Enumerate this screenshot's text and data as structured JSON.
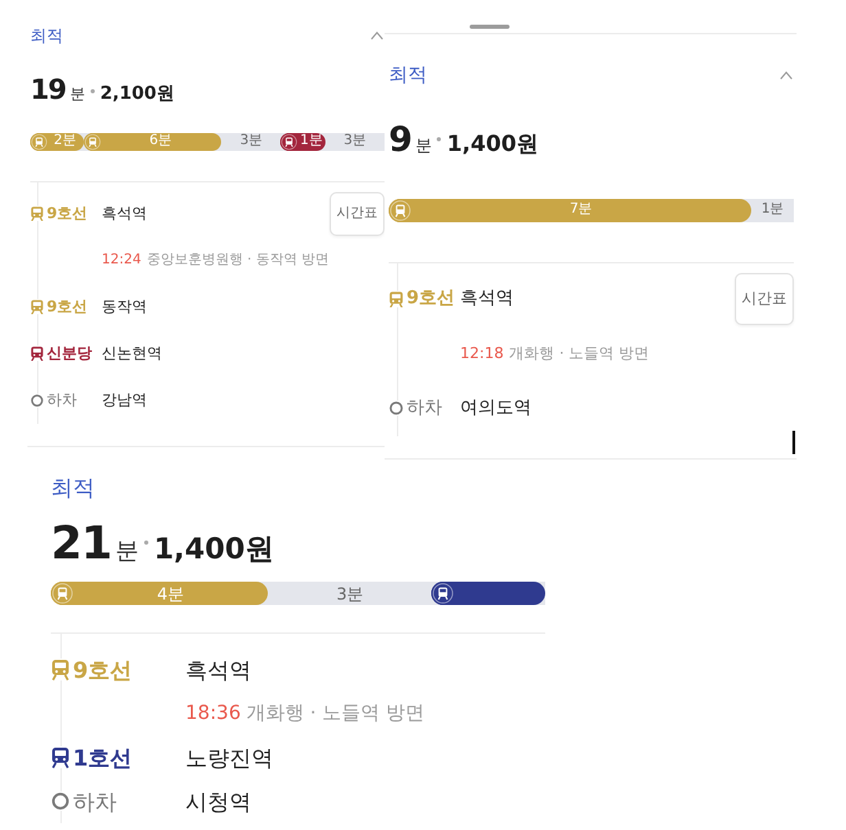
{
  "cards": [
    {
      "label": "최적",
      "expand_toggle": true,
      "duration": "19",
      "duration_unit": "분",
      "fare": "2,100원",
      "segments": [
        {
          "kind": "ride",
          "color": "#c9a646",
          "duration": "2분",
          "level": 0.15
        },
        {
          "kind": "ride",
          "color": "#c9a646",
          "duration": "6분",
          "level": 0.39
        },
        {
          "kind": "walk",
          "duration": "3분"
        },
        {
          "kind": "ride",
          "color": "#a3263d",
          "duration": "1분"
        },
        {
          "kind": "walk",
          "duration": "3분"
        }
      ],
      "legs": [
        {
          "kind": "board",
          "line": "9호선",
          "color": "#c9a646",
          "station": "흑석역",
          "timetable_button": "시간표",
          "departure": {
            "time": "12:24",
            "direction": "중앙보훈병원행 · 동작역 방면"
          }
        },
        {
          "kind": "board",
          "line": "9호선",
          "color": "#c9a646",
          "station": "동작역"
        },
        {
          "kind": "board",
          "line": "신분당",
          "color": "#a3263d",
          "station": "신논현역"
        },
        {
          "kind": "alight",
          "label": "하차",
          "station": "강남역"
        }
      ]
    },
    {
      "handle": true,
      "label": "최적",
      "expand_toggle": true,
      "duration": "9",
      "duration_unit": "분",
      "fare": "1,400원",
      "segments": [
        {
          "kind": "ride",
          "color": "#c9a646",
          "duration": "7분",
          "level": 0.895
        },
        {
          "kind": "walk",
          "duration": "1분"
        }
      ],
      "legs": [
        {
          "kind": "board",
          "line": "9호선",
          "color": "#c9a646",
          "station": "흑석역",
          "timetable_button": "시간표",
          "departure": {
            "time": "12:18",
            "direction": "개화행 · 노들역 방면"
          }
        },
        {
          "kind": "alight",
          "label": "하차",
          "station": "여의도역"
        }
      ],
      "text_cursor": true
    },
    {
      "label": "최적",
      "duration": "21",
      "duration_unit": "분",
      "fare": "1,400원",
      "segments": [
        {
          "kind": "ride",
          "color": "#c9a646",
          "duration": "4분",
          "level": 0.44
        },
        {
          "kind": "walk",
          "duration": "3분"
        },
        {
          "kind": "ride",
          "color": "#2f3a8f",
          "level": 0.23
        }
      ],
      "legs": [
        {
          "kind": "board",
          "line": "9호선",
          "color": "#c9a646",
          "station": "흑석역",
          "departure": {
            "time": "18:36",
            "direction": "개화행 · 노들역 방면"
          }
        },
        {
          "kind": "board",
          "line": "1호선",
          "color": "#2f3a8f",
          "station": "노량진역"
        },
        {
          "kind": "alight",
          "label": "하차",
          "station": "시청역"
        }
      ]
    }
  ]
}
